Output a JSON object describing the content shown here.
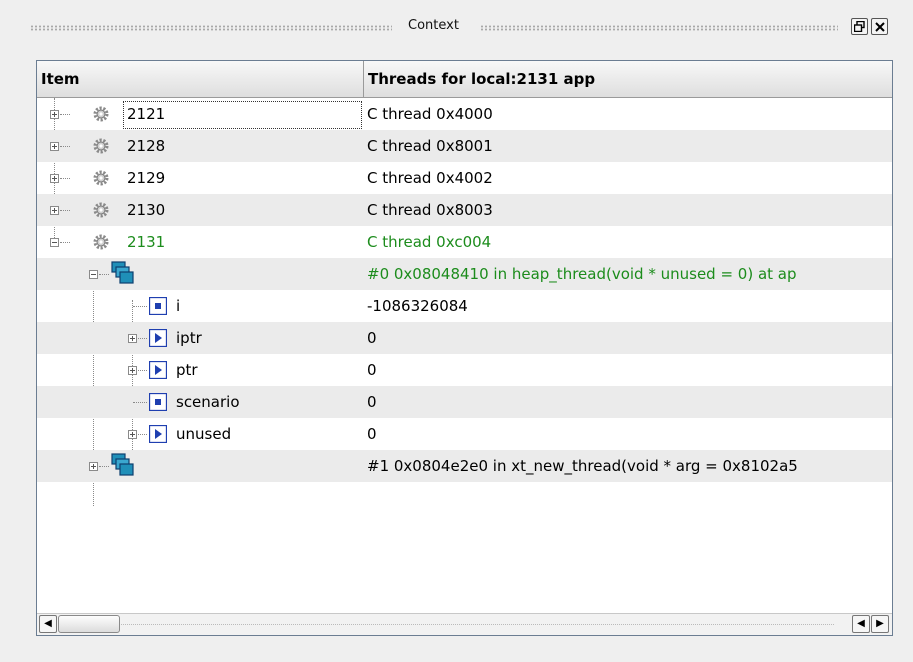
{
  "window": {
    "title": "Context"
  },
  "table": {
    "columns": [
      "Item",
      "Threads for local:2131 app"
    ],
    "rows": [
      {
        "item": "2121",
        "value": "C thread 0x4000",
        "kind": "process",
        "icon": "gear-icon"
      },
      {
        "item": "2128",
        "value": "C thread 0x8001",
        "kind": "process",
        "icon": "gear-icon"
      },
      {
        "item": "2129",
        "value": "C thread 0x4002",
        "kind": "process",
        "icon": "gear-icon"
      },
      {
        "item": "2130",
        "value": "C thread 0x8003",
        "kind": "process",
        "icon": "gear-icon"
      },
      {
        "item": "2131",
        "value": "C thread 0xc004",
        "kind": "process",
        "icon": "gear-icon",
        "highlight": "#1c8c1c"
      },
      {
        "item": "",
        "value": "#0 0x08048410 in heap_thread(void * unused = 0) at ap",
        "kind": "frame",
        "icon": "stack-frame-icon",
        "highlight": "#1c8c1c"
      },
      {
        "item": "i",
        "value": "-1086326084",
        "kind": "variable",
        "icon": "scalar-variable-icon"
      },
      {
        "item": "iptr",
        "value": "0",
        "kind": "variable",
        "icon": "pointer-variable-icon"
      },
      {
        "item": "ptr",
        "value": "0",
        "kind": "variable",
        "icon": "pointer-variable-icon"
      },
      {
        "item": "scenario",
        "value": "0",
        "kind": "variable",
        "icon": "scalar-variable-icon"
      },
      {
        "item": "unused",
        "value": "0",
        "kind": "variable",
        "icon": "pointer-variable-icon"
      },
      {
        "item": "",
        "value": "#1 0x0804e2e0 in xt_new_thread(void * arg = 0x8102a5",
        "kind": "frame",
        "icon": "stack-frame-icon"
      }
    ]
  },
  "colors": {
    "accent_green": "#1c8c1c",
    "variable_blue": "#1f3fb0",
    "frame_blue": "#1f8fb8"
  }
}
